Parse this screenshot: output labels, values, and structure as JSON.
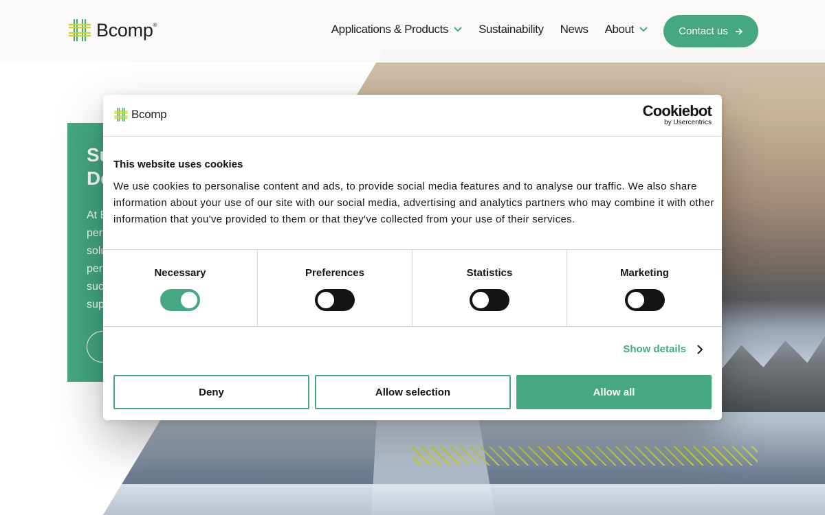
{
  "site": {
    "logo_text": "Bcomp",
    "logo_mark": "®"
  },
  "nav": {
    "items": [
      {
        "label": "Applications & Products",
        "has_dropdown": true
      },
      {
        "label": "Sustainability",
        "has_dropdown": false
      },
      {
        "label": "News",
        "has_dropdown": false
      },
      {
        "label": "About",
        "has_dropdown": true
      }
    ],
    "contact_label": "Contact us",
    "contact_icon": "arrow-right-icon"
  },
  "hero": {
    "title": "Su\nDe",
    "text": "At B\nperf\nsolu\nperf\nsuc\nsup"
  },
  "cookie_banner": {
    "brand": "Bcomp",
    "provider_name": "Cookiebot",
    "provider_by": "by Usercentrics",
    "title": "This website uses cookies",
    "body": "We use cookies to personalise content and ads, to provide social media features and to analyse our traffic. We also share information about your use of our site with our social media, advertising and analytics partners who may combine it with other information that you've provided to them or that they've collected from your use of their services.",
    "categories": [
      {
        "label": "Necessary",
        "checked": true
      },
      {
        "label": "Preferences",
        "checked": false
      },
      {
        "label": "Statistics",
        "checked": false
      },
      {
        "label": "Marketing",
        "checked": false
      }
    ],
    "show_details_label": "Show details",
    "deny_label": "Deny",
    "allow_selection_label": "Allow selection",
    "allow_all_label": "Allow all"
  },
  "colors": {
    "brand_green": "#45a882",
    "accent_lime": "#c9d52a",
    "text_dark": "#141414"
  }
}
